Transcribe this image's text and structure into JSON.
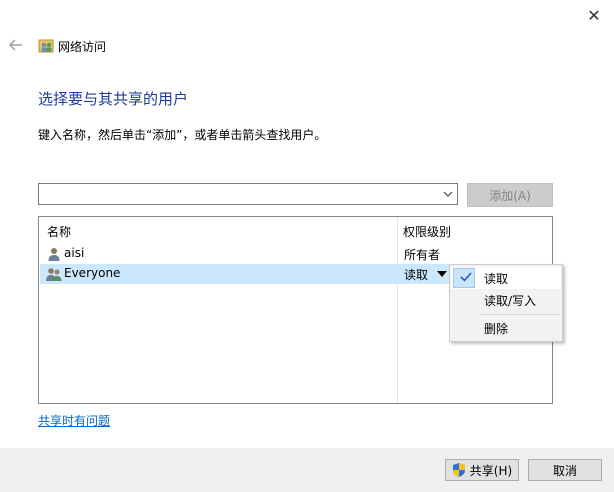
{
  "window": {
    "title": "网络访问",
    "close_glyph": "✕"
  },
  "page": {
    "heading": "选择要与其共享的用户",
    "instruction": "键入名称，然后单击“添加”，或者单击箭头查找用户。"
  },
  "name_input": {
    "value": "",
    "placeholder": ""
  },
  "add_button": {
    "label": "添加(A)"
  },
  "users_list": {
    "columns": [
      "名称",
      "权限级别"
    ],
    "rows": [
      {
        "name": "aisi",
        "permission": "所有者",
        "icon": "user-icon",
        "selected": false
      },
      {
        "name": "Everyone",
        "permission": "读取",
        "icon": "group-icon",
        "selected": true
      }
    ]
  },
  "permission_menu": {
    "items": [
      {
        "label": "读取",
        "checked": true
      },
      {
        "label": "读取/写入",
        "checked": false
      },
      {
        "label": "删除",
        "checked": false
      }
    ]
  },
  "help_link": "共享时有问题",
  "buttons": {
    "share": "共享(H)",
    "cancel": "取消"
  },
  "colors": {
    "heading": "#1e3a9a",
    "link": "#0066cc",
    "selection": "#cce8ff",
    "check": "#1f5dc6"
  }
}
